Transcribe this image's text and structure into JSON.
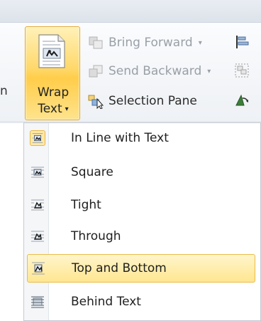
{
  "ribbon": {
    "edge_label": "n",
    "wrap_text": {
      "line1": "Wrap",
      "line2": "Text",
      "caret": "▾"
    },
    "arrange": [
      {
        "label": "Bring Forward",
        "caret": "▾",
        "disabled": true
      },
      {
        "label": "Send Backward",
        "caret": "▾",
        "disabled": true
      },
      {
        "label": "Selection Pane",
        "disabled": false
      }
    ]
  },
  "menu": {
    "items": [
      {
        "label": "In Line with Text",
        "checked": true
      },
      {
        "label": "Square"
      },
      {
        "label": "Tight"
      },
      {
        "label": "Through"
      },
      {
        "label": "Top and Bottom",
        "highlighted": true
      },
      {
        "label": "Behind Text"
      }
    ]
  },
  "colors": {
    "accent_orange": "#e3a82b",
    "hover_yellow": "#ffe690",
    "disabled_gray": "#9aa0a6"
  }
}
